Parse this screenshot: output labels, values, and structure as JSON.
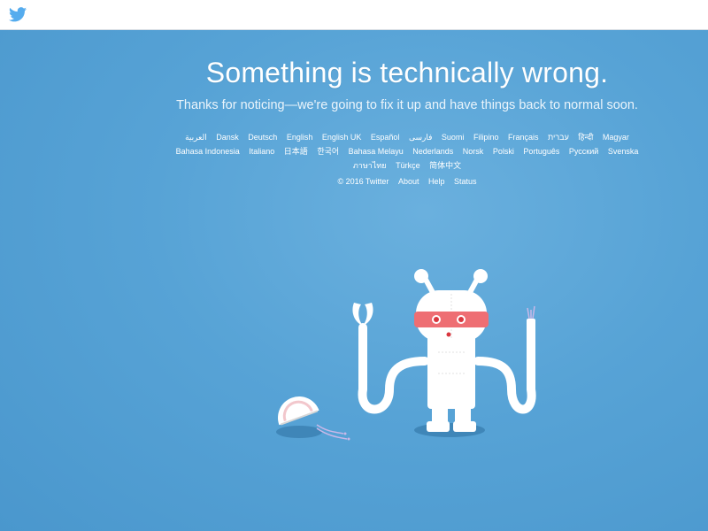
{
  "header": {
    "logo_icon": "twitter-bird-icon",
    "brand_color": "#55acee"
  },
  "error": {
    "headline": "Something is technically wrong.",
    "subline": "Thanks for noticing—we're going to fix it up and have things back to normal soon."
  },
  "languages": [
    "العربية",
    "Dansk",
    "Deutsch",
    "English",
    "English UK",
    "Español",
    "فارسی",
    "Suomi",
    "Filipino",
    "Français",
    "עברית",
    "हिन्दी",
    "Magyar",
    "Bahasa Indonesia",
    "Italiano",
    "日本語",
    "한국어",
    "Bahasa Melayu",
    "Nederlands",
    "Norsk",
    "Polski",
    "Português",
    "Русский",
    "Svenska",
    "ภาษาไทย",
    "Türkçe",
    "简体中文"
  ],
  "footer": {
    "copyright": "© 2016 Twitter",
    "links": [
      "About",
      "Help",
      "Status"
    ]
  },
  "illustration": {
    "name": "broken-robot-illustration",
    "colors": {
      "body": "#ffffff",
      "visor": "#ee6e73",
      "shadow": "#3a7fb0"
    }
  }
}
